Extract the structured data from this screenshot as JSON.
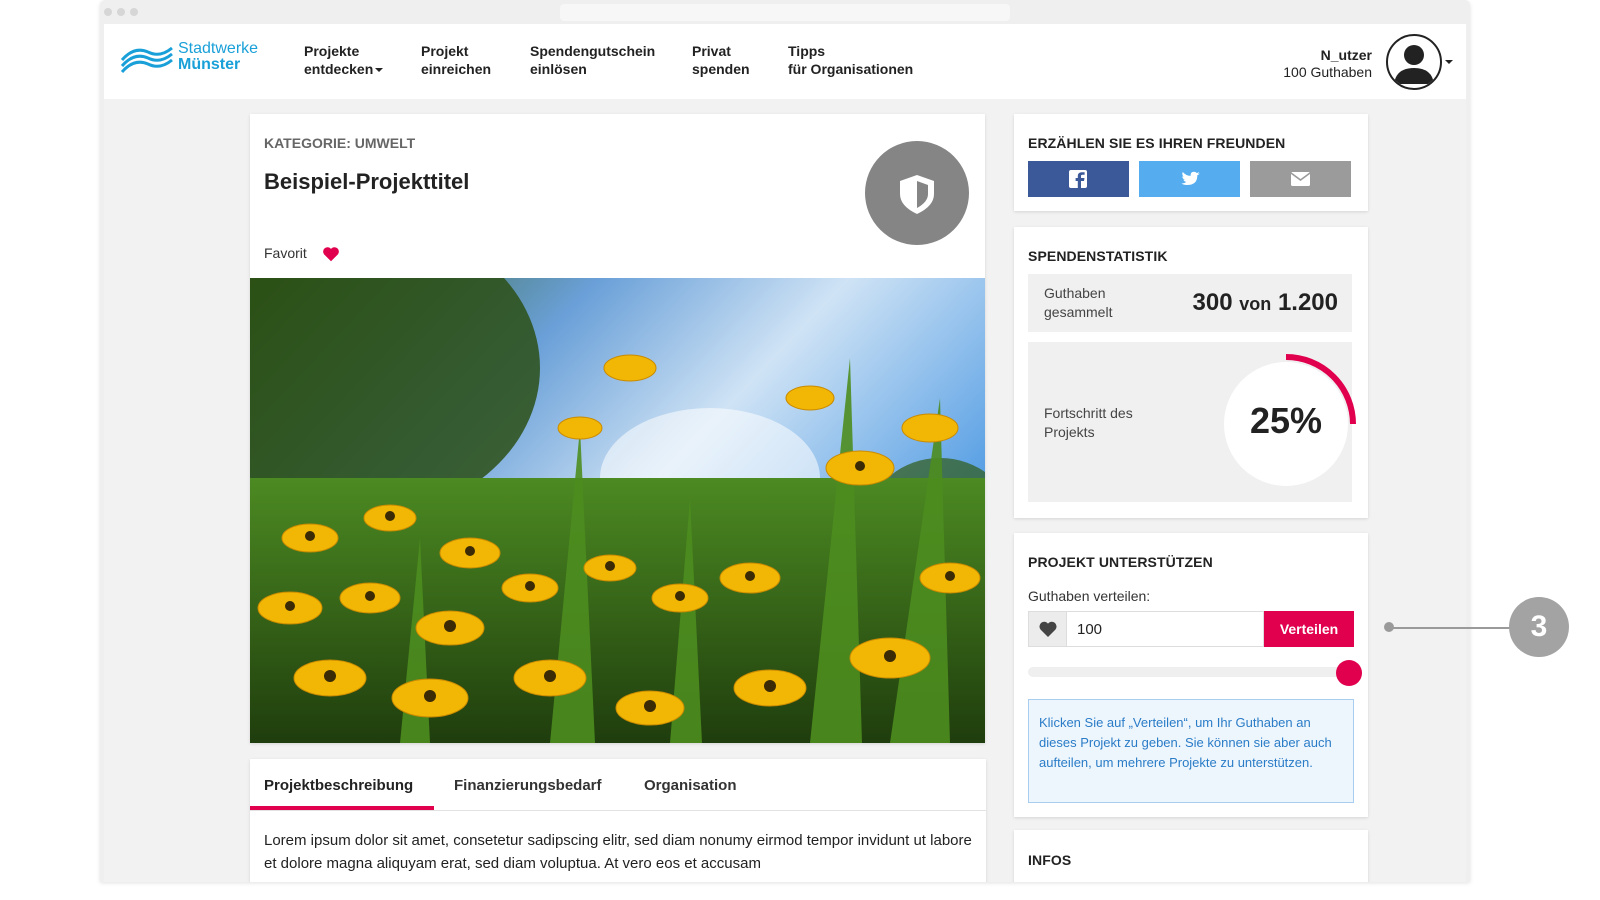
{
  "header": {
    "logo": {
      "line1": "Stadtwerke",
      "line2": "Münster"
    },
    "nav": [
      {
        "line1": "Projekte",
        "line2": "entdecken"
      },
      {
        "line1": "Projekt",
        "line2": "einreichen"
      },
      {
        "line1": "Spendengutschein",
        "line2": "einlösen"
      },
      {
        "line1": "Privat",
        "line2": "spenden"
      },
      {
        "line1": "Tipps",
        "line2": "für Organisationen"
      }
    ],
    "user": {
      "name": "N_utzer",
      "credit": "100 Guthaben"
    }
  },
  "project": {
    "category": "KATEGORIE: UMWELT",
    "title": "Beispiel-Projekttitel",
    "favorite_label": "Favorit"
  },
  "tabs": {
    "items": [
      "Projektbeschreibung",
      "Finanzierungsbedarf",
      "Organisation"
    ],
    "active_index": 0,
    "body": "Lorem ipsum dolor sit amet, consetetur sadipscing elitr, sed diam nonumy eirmod tempor invidunt ut labore et dolore magna aliquyam erat, sed diam voluptua. At vero eos et accusam"
  },
  "share": {
    "heading": "ERZÄHLEN SIE ES IHREN FREUNDEN",
    "buttons": [
      {
        "network": "facebook",
        "icon": "facebook-icon",
        "color": "#3b5998"
      },
      {
        "network": "twitter",
        "icon": "twitter-icon",
        "color": "#55acee"
      },
      {
        "network": "email",
        "icon": "envelope-icon",
        "color": "#9b9b9b"
      }
    ]
  },
  "stats": {
    "heading": "SPENDENSTATISTIK",
    "collected_label_1": "Guthaben",
    "collected_label_2": "gesammelt",
    "collected": "300",
    "von": "von",
    "goal": "1.200",
    "progress_label_1": "Fortschritt des",
    "progress_label_2": "Projekts",
    "progress_text": "25%",
    "progress_fraction": 0.25
  },
  "support": {
    "heading": "PROJEKT UNTERSTÜTZEN",
    "distribute_label": "Guthaben verteilen:",
    "amount": "100",
    "button": "Verteilen",
    "slider_fraction": 1.0,
    "info": "Klicken Sie auf „Verteilen“, um Ihr Guthaben an dieses Projekt zu geben. Sie können sie aber auch aufteilen, um mehrere Projekte zu unterstützen."
  },
  "infos": {
    "heading": "INFOS"
  },
  "annotation": {
    "number": "3"
  },
  "colors": {
    "accent": "#e0004d",
    "brand": "#1aa0d8",
    "info_text": "#2a7cc7"
  }
}
